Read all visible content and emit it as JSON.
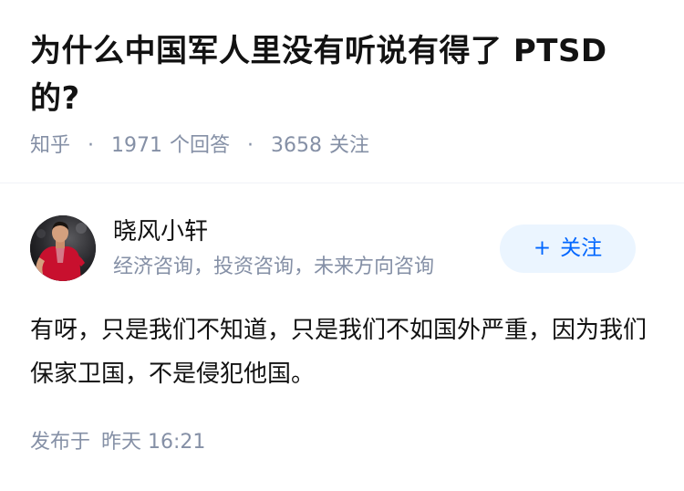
{
  "question": {
    "title": "为什么中国军人里没有听说有得了 PTSD 的?",
    "source": "知乎",
    "answer_count": "1971",
    "answer_label": "个回答",
    "follow_count": "3658",
    "follow_label": "关注"
  },
  "author": {
    "name": "晓风小轩",
    "bio": "经济咨询，投资咨询，未来方向咨询",
    "follow_button": "关注",
    "follow_icon": "plus-icon"
  },
  "answer": {
    "text": "有呀，只是我们不知道，只是我们不如国外严重，因为我们保家卫国，不是侵犯他国。"
  },
  "footer": {
    "published_label": "发布于",
    "published_time": "昨天 16:21"
  },
  "colors": {
    "text_primary": "#121212",
    "text_secondary": "#8590a6",
    "accent": "#0066ff",
    "accent_bg": "#ebf5ff",
    "divider": "#f0f2f7"
  }
}
